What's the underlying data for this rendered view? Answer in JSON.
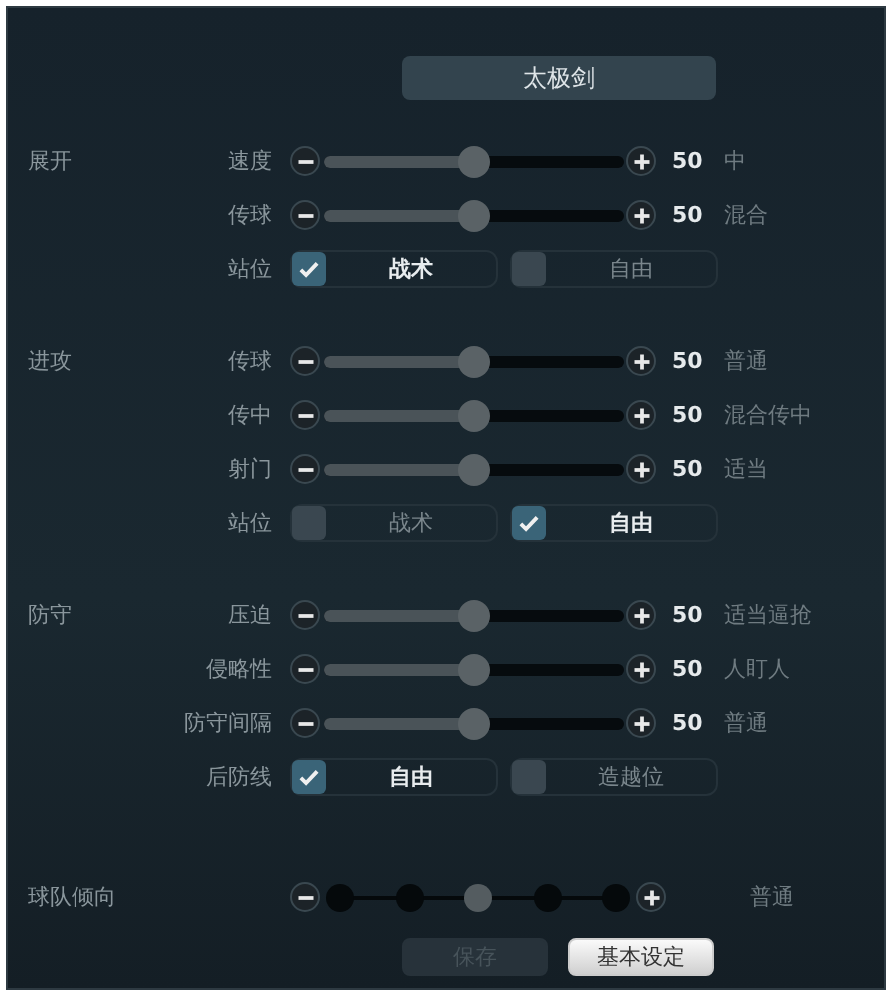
{
  "title": "太极剑",
  "sections": [
    {
      "label": "展开",
      "rows": [
        {
          "kind": "slider",
          "label": "速度",
          "level": 0.5,
          "value": "50",
          "description": "中"
        },
        {
          "kind": "slider",
          "label": "传球",
          "level": 0.5,
          "value": "50",
          "description": "混合"
        },
        {
          "kind": "choice",
          "label": "站位",
          "options": [
            {
              "label": "战术",
              "selected": true
            },
            {
              "label": "自由",
              "selected": false
            }
          ]
        }
      ]
    },
    {
      "label": "进攻",
      "rows": [
        {
          "kind": "slider",
          "label": "传球",
          "level": 0.5,
          "value": "50",
          "description": "普通"
        },
        {
          "kind": "slider",
          "label": "传中",
          "level": 0.5,
          "value": "50",
          "description": "混合传中"
        },
        {
          "kind": "slider",
          "label": "射门",
          "level": 0.5,
          "value": "50",
          "description": "适当"
        },
        {
          "kind": "choice",
          "label": "站位",
          "options": [
            {
              "label": "战术",
              "selected": false
            },
            {
              "label": "自由",
              "selected": true
            }
          ]
        }
      ]
    },
    {
      "label": "防守",
      "rows": [
        {
          "kind": "slider",
          "label": "压迫",
          "level": 0.5,
          "value": "50",
          "description": "适当逼抢"
        },
        {
          "kind": "slider",
          "label": "侵略性",
          "level": 0.5,
          "value": "50",
          "description": "人盯人"
        },
        {
          "kind": "slider",
          "label": "防守间隔",
          "level": 0.5,
          "value": "50",
          "description": "普通"
        },
        {
          "kind": "choice",
          "label": "后防线",
          "options": [
            {
              "label": "自由",
              "selected": true
            },
            {
              "label": "造越位",
              "selected": false
            }
          ]
        }
      ]
    }
  ],
  "tendency": {
    "label": "球队倾向",
    "level": 0.5,
    "description": "普通"
  },
  "buttons": [
    {
      "label": "保存",
      "disabled": true
    },
    {
      "label": "基本设定",
      "disabled": false
    }
  ]
}
